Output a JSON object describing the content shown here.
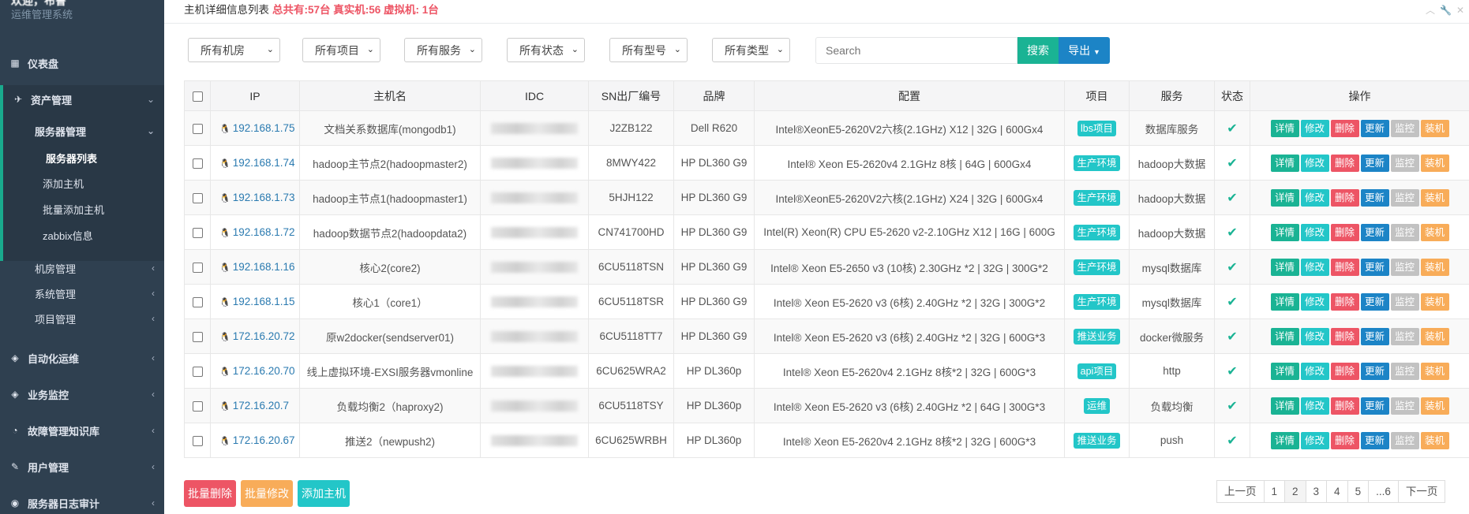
{
  "sidebar": {
    "user_name": "欢迎，布鲁",
    "system_name": "运维管理系统",
    "items": [
      {
        "label": "仪表盘",
        "icon": "dashboard-icon"
      },
      {
        "label": "资产管理",
        "icon": "rocket-icon"
      },
      {
        "label": "自动化运维",
        "icon": "cube-icon"
      },
      {
        "label": "业务监控",
        "icon": "cube-icon"
      },
      {
        "label": "故障管理知识库",
        "icon": "dashboard-gauge-icon"
      },
      {
        "label": "用户管理",
        "icon": "edit-icon"
      },
      {
        "label": "服务器日志审计",
        "icon": "eye-icon"
      }
    ],
    "asset_sub": [
      {
        "label": "服务器管理"
      },
      {
        "label": "机房管理"
      },
      {
        "label": "系统管理"
      },
      {
        "label": "项目管理"
      }
    ],
    "server_sub": [
      {
        "label": "服务器列表"
      },
      {
        "label": "添加主机"
      },
      {
        "label": "批量添加主机"
      },
      {
        "label": "zabbix信息"
      }
    ]
  },
  "header": {
    "title": "主机详细信息列表",
    "stats": "总共有:57台 真实机:56 虚拟机: 1台"
  },
  "filters": [
    {
      "label": "所有机房"
    },
    {
      "label": "所有项目"
    },
    {
      "label": "所有服务"
    },
    {
      "label": "所有状态"
    },
    {
      "label": "所有型号"
    },
    {
      "label": "所有类型"
    }
  ],
  "search": {
    "placeholder": "Search",
    "button": "搜索",
    "export": "导出"
  },
  "table": {
    "headers": [
      "IP",
      "主机名",
      "IDC",
      "SN出厂编号",
      "品牌",
      "配置",
      "项目",
      "服务",
      "状态",
      "操作"
    ],
    "actions": [
      {
        "label": "详情",
        "color": "#1ab394"
      },
      {
        "label": "修改",
        "color": "#23c6c8"
      },
      {
        "label": "删除",
        "color": "#ed5565"
      },
      {
        "label": "更新",
        "color": "#1c84c6"
      },
      {
        "label": "监控",
        "color": "#c2c2c2"
      },
      {
        "label": "装机",
        "color": "#f8ac59"
      }
    ],
    "rows": [
      {
        "ip": "192.168.1.75",
        "hostname": "文档关系数据库(mongodb1)",
        "sn": "J2ZB122",
        "brand": "Dell R620",
        "config": "Intel®XeonE5-2620V2六核(2.1GHz) X12 | 32G | 600Gx4",
        "project": "lbs项目",
        "project_color": "#23c6c8",
        "service": "数据库服务"
      },
      {
        "ip": "192.168.1.74",
        "hostname": "hadoop主节点2(hadoopmaster2)",
        "sn": "8MWY422",
        "brand": "HP DL360 G9",
        "config": "Intel® Xeon E5-2620v4 2.1GHz 8核 | 64G | 600Gx4",
        "project": "生产环境",
        "project_color": "#23c6c8",
        "service": "hadoop大数据"
      },
      {
        "ip": "192.168.1.73",
        "hostname": "hadoop主节点1(hadoopmaster1)",
        "sn": "5HJH122",
        "brand": "HP DL360 G9",
        "config": "Intel®XeonE5-2620V2六核(2.1GHz) X24 | 32G | 600Gx4",
        "project": "生产环境",
        "project_color": "#23c6c8",
        "service": "hadoop大数据"
      },
      {
        "ip": "192.168.1.72",
        "hostname": "hadoop数据节点2(hadoopdata2)",
        "sn": "CN741700HD",
        "brand": "HP DL360 G9",
        "config": "Intel(R) Xeon(R) CPU E5-2620 v2-2.10GHz X12 | 16G | 600G",
        "project": "生产环境",
        "project_color": "#23c6c8",
        "service": "hadoop大数据"
      },
      {
        "ip": "192.168.1.16",
        "hostname": "核心2(core2)",
        "sn": "6CU5118TSN",
        "brand": "HP DL360 G9",
        "config": "Intel® Xeon E5-2650 v3 (10核) 2.30GHz *2 | 32G | 300G*2",
        "project": "生产环境",
        "project_color": "#23c6c8",
        "service": "mysql数据库"
      },
      {
        "ip": "192.168.1.15",
        "hostname": "核心1（core1）",
        "sn": "6CU5118TSR",
        "brand": "HP DL360 G9",
        "config": "Intel® Xeon E5-2620 v3 (6核) 2.40GHz *2 | 32G | 300G*2",
        "project": "生产环境",
        "project_color": "#23c6c8",
        "service": "mysql数据库"
      },
      {
        "ip": "172.16.20.72",
        "hostname": "原w2docker(sendserver01)",
        "sn": "6CU5118TT7",
        "brand": "HP DL360 G9",
        "config": "Intel® Xeon E5-2620 v3 (6核) 2.40GHz *2 | 32G | 600G*3",
        "project": "推送业务",
        "project_color": "#23c6c8",
        "service": "docker微服务"
      },
      {
        "ip": "172.16.20.70",
        "hostname": "线上虚拟环境-EXSI服务器vmonline",
        "sn": "6CU625WRA2",
        "brand": "HP DL360p",
        "config": "Intel® Xeon E5-2620v4 2.1GHz 8核*2 | 32G | 600G*3",
        "project": "api项目",
        "project_color": "#23c6c8",
        "service": "http"
      },
      {
        "ip": "172.16.20.7",
        "hostname": "负载均衡2（haproxy2)",
        "sn": "6CU5118TSY",
        "brand": "HP DL360p",
        "config": "Intel® Xeon E5-2620 v3 (6核) 2.40GHz *2 | 64G | 300G*3",
        "project": "运维",
        "project_color": "#23c6c8",
        "service": "负载均衡"
      },
      {
        "ip": "172.16.20.67",
        "hostname": "推送2（newpush2)",
        "sn": "6CU625WRBH",
        "brand": "HP DL360p",
        "config": "Intel® Xeon E5-2620v4 2.1GHz 8核*2 | 32G | 600G*3",
        "project": "推送业务",
        "project_color": "#23c6c8",
        "service": "push"
      }
    ]
  },
  "bottom": {
    "batch_delete": "批量删除",
    "batch_edit": "批量修改",
    "add_host": "添加主机"
  },
  "pagination": {
    "prev": "上一页",
    "pages": [
      "1",
      "2",
      "3",
      "4",
      "5",
      "...6"
    ],
    "active": "2",
    "next": "下一页"
  }
}
